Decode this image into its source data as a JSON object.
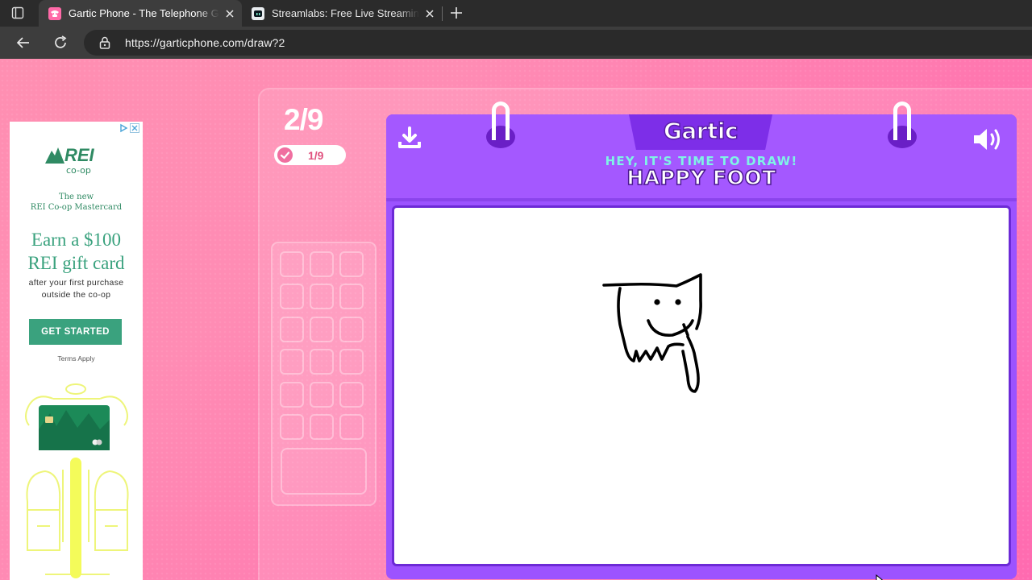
{
  "browser": {
    "tabs": [
      {
        "title": "Gartic Phone - The Telephone Game",
        "active": true,
        "favicon": "gartic-phone-favicon"
      },
      {
        "title": "Streamlabs: Free Live Streaming and Tools",
        "active": false,
        "favicon": "streamlabs-favicon"
      }
    ],
    "url": "https://garticphone.com/draw?2"
  },
  "ad": {
    "brand": "REI",
    "brand_sub": "co-op",
    "intro_line1": "The new",
    "intro_line2": "REI Co-op  Mastercard",
    "headline_line1": "Earn a $100",
    "headline_line2": "REI gift card",
    "sub_line1": "after your first purchase",
    "sub_line2": "outside the co-op",
    "cta": "GET STARTED",
    "terms": "Terms Apply"
  },
  "game": {
    "round": "2/9",
    "progress": "1/9",
    "logo": "Gartic",
    "prompt_intro": "HEY, IT'S TIME TO DRAW!",
    "prompt_word": "HAPPY FOOT"
  },
  "colors": {
    "page_bg": "#ff8cb4",
    "book_purple": "#a458ff",
    "prompt_cyan": "#7ff3e6",
    "ad_green": "#3aa27e"
  }
}
